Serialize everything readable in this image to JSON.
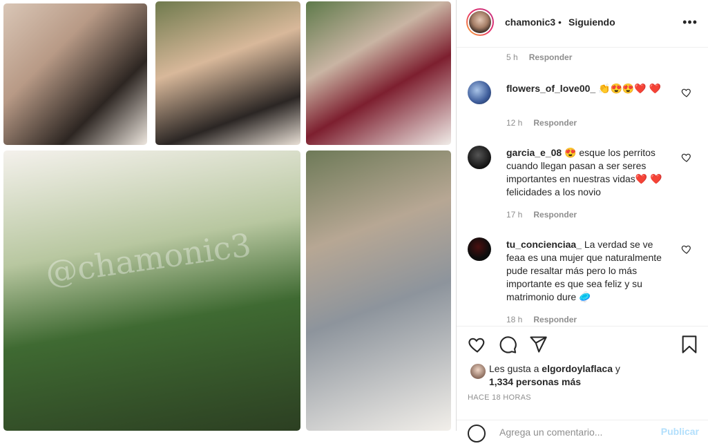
{
  "header": {
    "username": "chamonic3",
    "separator": "•",
    "following": "Siguiendo",
    "more": "•••"
  },
  "photo": {
    "watermark": "@chamonic3"
  },
  "comments": {
    "prev_meta": {
      "time": "5 h",
      "reply": "Responder"
    },
    "items": [
      {
        "username": "flowers_of_love00_",
        "text": "👏😍😍❤️ ❤️",
        "time": "12 h",
        "reply": "Responder"
      },
      {
        "username": "garcia_e_08",
        "text": "😍 esque los perritos cuando llegan pasan a ser seres importantes en nuestras vidas❤️ ❤️ felicidades a los novio",
        "time": "17 h",
        "reply": "Responder"
      },
      {
        "username": "tu_concienciaa_",
        "text": "La verdad se ve feaa es una mujer que naturalmente pude resaltar más pero lo más importante es que sea feliz y su matrimonio dure 🥏",
        "time": "18 h",
        "reply": "Responder"
      }
    ]
  },
  "likes": {
    "prefix": "Les gusta a",
    "user": "elgordoylaflaca",
    "conj": "y",
    "others": "1,334 personas más"
  },
  "timeago": "HACE 18 HORAS",
  "comment_box": {
    "placeholder": "Agrega un comentario...",
    "publish": "Publicar"
  },
  "colors": {
    "link_disabled": "#b2dffc",
    "secondary_text": "#8e8e8e",
    "heart": "#ed4956"
  }
}
